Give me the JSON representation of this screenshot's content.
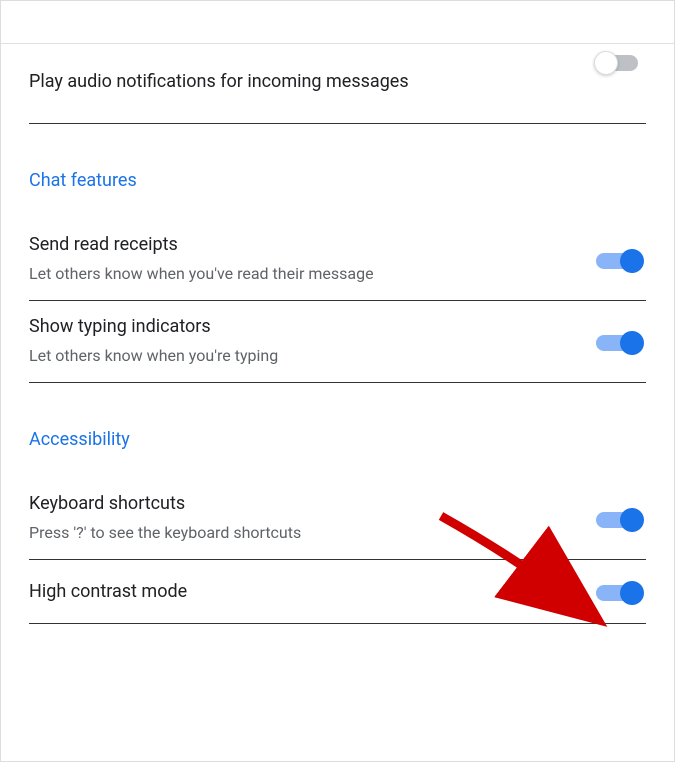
{
  "settings": {
    "notifications": {
      "audio": {
        "title": "Play audio notifications for incoming messages",
        "enabled": false
      }
    },
    "chatFeatures": {
      "sectionTitle": "Chat features",
      "readReceipts": {
        "title": "Send read receipts",
        "subtitle": "Let others know when you've read their message",
        "enabled": true
      },
      "typingIndicators": {
        "title": "Show typing indicators",
        "subtitle": "Let others know when you're typing",
        "enabled": true
      }
    },
    "accessibility": {
      "sectionTitle": "Accessibility",
      "keyboardShortcuts": {
        "title": "Keyboard shortcuts",
        "subtitle": "Press '?' to see the keyboard shortcuts",
        "enabled": true
      },
      "highContrast": {
        "title": "High contrast mode",
        "enabled": true
      }
    }
  }
}
